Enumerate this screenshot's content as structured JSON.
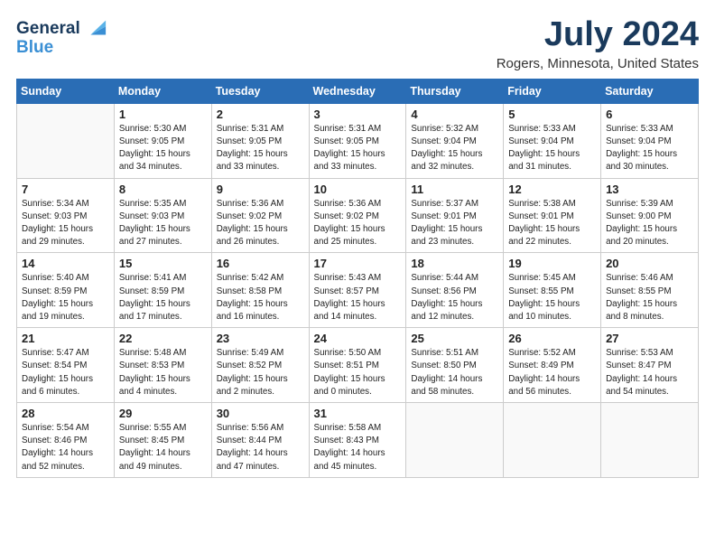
{
  "header": {
    "logo_line1": "General",
    "logo_line2": "Blue",
    "month_title": "July 2024",
    "location": "Rogers, Minnesota, United States"
  },
  "days_of_week": [
    "Sunday",
    "Monday",
    "Tuesday",
    "Wednesday",
    "Thursday",
    "Friday",
    "Saturday"
  ],
  "weeks": [
    [
      {
        "day": "",
        "sunrise": "",
        "sunset": "",
        "daylight": ""
      },
      {
        "day": "1",
        "sunrise": "Sunrise: 5:30 AM",
        "sunset": "Sunset: 9:05 PM",
        "daylight": "Daylight: 15 hours and 34 minutes."
      },
      {
        "day": "2",
        "sunrise": "Sunrise: 5:31 AM",
        "sunset": "Sunset: 9:05 PM",
        "daylight": "Daylight: 15 hours and 33 minutes."
      },
      {
        "day": "3",
        "sunrise": "Sunrise: 5:31 AM",
        "sunset": "Sunset: 9:05 PM",
        "daylight": "Daylight: 15 hours and 33 minutes."
      },
      {
        "day": "4",
        "sunrise": "Sunrise: 5:32 AM",
        "sunset": "Sunset: 9:04 PM",
        "daylight": "Daylight: 15 hours and 32 minutes."
      },
      {
        "day": "5",
        "sunrise": "Sunrise: 5:33 AM",
        "sunset": "Sunset: 9:04 PM",
        "daylight": "Daylight: 15 hours and 31 minutes."
      },
      {
        "day": "6",
        "sunrise": "Sunrise: 5:33 AM",
        "sunset": "Sunset: 9:04 PM",
        "daylight": "Daylight: 15 hours and 30 minutes."
      }
    ],
    [
      {
        "day": "7",
        "sunrise": "Sunrise: 5:34 AM",
        "sunset": "Sunset: 9:03 PM",
        "daylight": "Daylight: 15 hours and 29 minutes."
      },
      {
        "day": "8",
        "sunrise": "Sunrise: 5:35 AM",
        "sunset": "Sunset: 9:03 PM",
        "daylight": "Daylight: 15 hours and 27 minutes."
      },
      {
        "day": "9",
        "sunrise": "Sunrise: 5:36 AM",
        "sunset": "Sunset: 9:02 PM",
        "daylight": "Daylight: 15 hours and 26 minutes."
      },
      {
        "day": "10",
        "sunrise": "Sunrise: 5:36 AM",
        "sunset": "Sunset: 9:02 PM",
        "daylight": "Daylight: 15 hours and 25 minutes."
      },
      {
        "day": "11",
        "sunrise": "Sunrise: 5:37 AM",
        "sunset": "Sunset: 9:01 PM",
        "daylight": "Daylight: 15 hours and 23 minutes."
      },
      {
        "day": "12",
        "sunrise": "Sunrise: 5:38 AM",
        "sunset": "Sunset: 9:01 PM",
        "daylight": "Daylight: 15 hours and 22 minutes."
      },
      {
        "day": "13",
        "sunrise": "Sunrise: 5:39 AM",
        "sunset": "Sunset: 9:00 PM",
        "daylight": "Daylight: 15 hours and 20 minutes."
      }
    ],
    [
      {
        "day": "14",
        "sunrise": "Sunrise: 5:40 AM",
        "sunset": "Sunset: 8:59 PM",
        "daylight": "Daylight: 15 hours and 19 minutes."
      },
      {
        "day": "15",
        "sunrise": "Sunrise: 5:41 AM",
        "sunset": "Sunset: 8:59 PM",
        "daylight": "Daylight: 15 hours and 17 minutes."
      },
      {
        "day": "16",
        "sunrise": "Sunrise: 5:42 AM",
        "sunset": "Sunset: 8:58 PM",
        "daylight": "Daylight: 15 hours and 16 minutes."
      },
      {
        "day": "17",
        "sunrise": "Sunrise: 5:43 AM",
        "sunset": "Sunset: 8:57 PM",
        "daylight": "Daylight: 15 hours and 14 minutes."
      },
      {
        "day": "18",
        "sunrise": "Sunrise: 5:44 AM",
        "sunset": "Sunset: 8:56 PM",
        "daylight": "Daylight: 15 hours and 12 minutes."
      },
      {
        "day": "19",
        "sunrise": "Sunrise: 5:45 AM",
        "sunset": "Sunset: 8:55 PM",
        "daylight": "Daylight: 15 hours and 10 minutes."
      },
      {
        "day": "20",
        "sunrise": "Sunrise: 5:46 AM",
        "sunset": "Sunset: 8:55 PM",
        "daylight": "Daylight: 15 hours and 8 minutes."
      }
    ],
    [
      {
        "day": "21",
        "sunrise": "Sunrise: 5:47 AM",
        "sunset": "Sunset: 8:54 PM",
        "daylight": "Daylight: 15 hours and 6 minutes."
      },
      {
        "day": "22",
        "sunrise": "Sunrise: 5:48 AM",
        "sunset": "Sunset: 8:53 PM",
        "daylight": "Daylight: 15 hours and 4 minutes."
      },
      {
        "day": "23",
        "sunrise": "Sunrise: 5:49 AM",
        "sunset": "Sunset: 8:52 PM",
        "daylight": "Daylight: 15 hours and 2 minutes."
      },
      {
        "day": "24",
        "sunrise": "Sunrise: 5:50 AM",
        "sunset": "Sunset: 8:51 PM",
        "daylight": "Daylight: 15 hours and 0 minutes."
      },
      {
        "day": "25",
        "sunrise": "Sunrise: 5:51 AM",
        "sunset": "Sunset: 8:50 PM",
        "daylight": "Daylight: 14 hours and 58 minutes."
      },
      {
        "day": "26",
        "sunrise": "Sunrise: 5:52 AM",
        "sunset": "Sunset: 8:49 PM",
        "daylight": "Daylight: 14 hours and 56 minutes."
      },
      {
        "day": "27",
        "sunrise": "Sunrise: 5:53 AM",
        "sunset": "Sunset: 8:47 PM",
        "daylight": "Daylight: 14 hours and 54 minutes."
      }
    ],
    [
      {
        "day": "28",
        "sunrise": "Sunrise: 5:54 AM",
        "sunset": "Sunset: 8:46 PM",
        "daylight": "Daylight: 14 hours and 52 minutes."
      },
      {
        "day": "29",
        "sunrise": "Sunrise: 5:55 AM",
        "sunset": "Sunset: 8:45 PM",
        "daylight": "Daylight: 14 hours and 49 minutes."
      },
      {
        "day": "30",
        "sunrise": "Sunrise: 5:56 AM",
        "sunset": "Sunset: 8:44 PM",
        "daylight": "Daylight: 14 hours and 47 minutes."
      },
      {
        "day": "31",
        "sunrise": "Sunrise: 5:58 AM",
        "sunset": "Sunset: 8:43 PM",
        "daylight": "Daylight: 14 hours and 45 minutes."
      },
      {
        "day": "",
        "sunrise": "",
        "sunset": "",
        "daylight": ""
      },
      {
        "day": "",
        "sunrise": "",
        "sunset": "",
        "daylight": ""
      },
      {
        "day": "",
        "sunrise": "",
        "sunset": "",
        "daylight": ""
      }
    ]
  ]
}
